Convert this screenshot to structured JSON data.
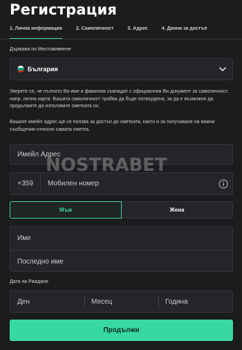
{
  "page": {
    "title": "Регистрация"
  },
  "steps": [
    {
      "label": "1. Лична информация",
      "active": true
    },
    {
      "label": "2. Самоличност",
      "active": false
    },
    {
      "label": "3. Адрес",
      "active": false
    },
    {
      "label": "4. Данни за достъп",
      "active": false
    }
  ],
  "country": {
    "label": "Държава по Местоживеене",
    "value": "България",
    "flag_colors": [
      "#ffffff",
      "#00966e",
      "#d62612"
    ]
  },
  "notes": {
    "identity": "Уверете се, че пълното Ви име и фамилия съвпадат с официалния Ви документ за самоличност, напр. лична карта. Вашата самоличност трябва да бъде потвърдена, за да е възможно да продължите да използвате сметката си.",
    "email": "Вашият имейл адрес ще се ползва за достъп до сметката, както и за получаване на важни съобщения относно самата сметка."
  },
  "form": {
    "email_placeholder": "Имейл Адрес",
    "phone_prefix": "+359",
    "phone_placeholder": "Мобилен номер",
    "gender_male": "Мъж",
    "gender_female": "Жена",
    "first_name_placeholder": "Име",
    "last_name_placeholder": "Последно име",
    "dob_label": "Дата на Раждане",
    "dob_day": "Ден",
    "dob_month": "Месец",
    "dob_year": "Година",
    "submit": "Продължи"
  },
  "watermark": "NOSTRABET",
  "colors": {
    "accent": "#38d9a1",
    "background": "#1b1c1e",
    "field": "#242528"
  }
}
